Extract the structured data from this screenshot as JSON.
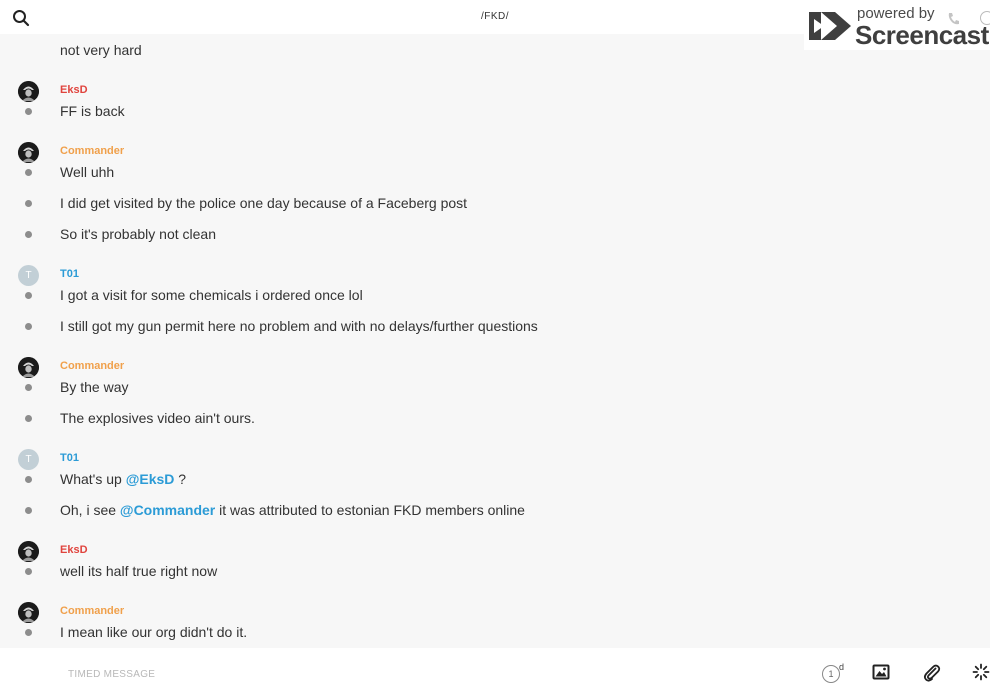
{
  "header": {
    "title": "/FKD/",
    "search_icon": "search-icon"
  },
  "watermark": {
    "powered_by": "powered by",
    "brand": "Screencastify"
  },
  "messages": [
    {
      "author": "EksD",
      "color": "#e0443e",
      "avatar": "dark",
      "lines": [
        {
          "text": "FF is back"
        }
      ]
    },
    {
      "author": "Commander",
      "color": "#f0a04b",
      "avatar": "dark",
      "lines": [
        {
          "text": "Well uhh"
        },
        {
          "text": "I did get visited by the police one day because of a Faceberg post"
        },
        {
          "text": "So it's probably not clean"
        }
      ]
    },
    {
      "author": "T01",
      "color": "#2b9bd6",
      "avatar": "light",
      "initial": "T",
      "lines": [
        {
          "text": "I got a visit for some chemicals i ordered once lol"
        },
        {
          "text": "I still got my gun permit here no problem and with no delays/further questions"
        }
      ]
    },
    {
      "author": "Commander",
      "color": "#f0a04b",
      "avatar": "dark",
      "lines": [
        {
          "text": "By the way"
        },
        {
          "text": "The explosives video ain't ours."
        }
      ]
    },
    {
      "author": "T01",
      "color": "#2b9bd6",
      "avatar": "light",
      "initial": "T",
      "lines": [
        {
          "pre": "What's up ",
          "mention": "@EksD",
          "post": " ?"
        },
        {
          "pre": "Oh, i see ",
          "mention": "@Commander",
          "post": "  it was attributed to estonian FKD members online"
        }
      ]
    },
    {
      "author": "EksD",
      "color": "#e0443e",
      "avatar": "dark",
      "lines": [
        {
          "text": "well its half true right now"
        }
      ]
    },
    {
      "author": "Commander",
      "color": "#f0a04b",
      "avatar": "dark",
      "lines": [
        {
          "text": "I mean like our org didn't do it."
        }
      ]
    }
  ],
  "cut_off_line": "not very hard",
  "composer": {
    "placeholder": "TIMED MESSAGE",
    "timer_value": "1",
    "timer_unit": "d",
    "image_icon": "image-icon",
    "attach_icon": "paperclip-icon",
    "loading_icon": "spinner-icon"
  }
}
